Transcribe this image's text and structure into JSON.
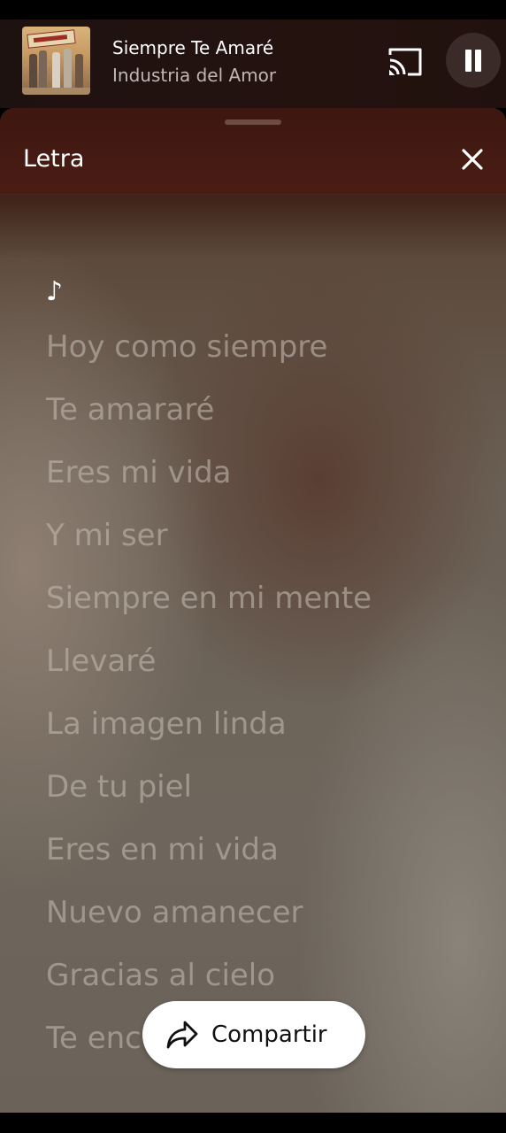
{
  "mini_player": {
    "title": "Siempre Te Amaré",
    "artist": "Industria del Amor",
    "album_art_icon": "album-cover",
    "cast_icon": "cast-icon",
    "pause_icon": "pause-icon"
  },
  "lyrics_sheet": {
    "title": "Letra",
    "close_icon": "close-icon",
    "note": "♪",
    "lines": [
      "Hoy como siempre",
      "Te amararé",
      "Eres mi vida",
      "Y mi ser",
      "Siempre en mi mente",
      "Llevaré",
      "La imagen linda",
      "De tu piel",
      "Eres en mi vida",
      "Nuevo amanecer",
      "Gracias al cielo",
      "Te enc"
    ]
  },
  "share": {
    "label": "Compartir",
    "icon": "share-icon"
  },
  "colors": {
    "header_bg": "#3d1710",
    "mini_player_bg": "#1e1211",
    "lyric_dim": "#beb6ac",
    "share_bg": "#ffffff"
  }
}
